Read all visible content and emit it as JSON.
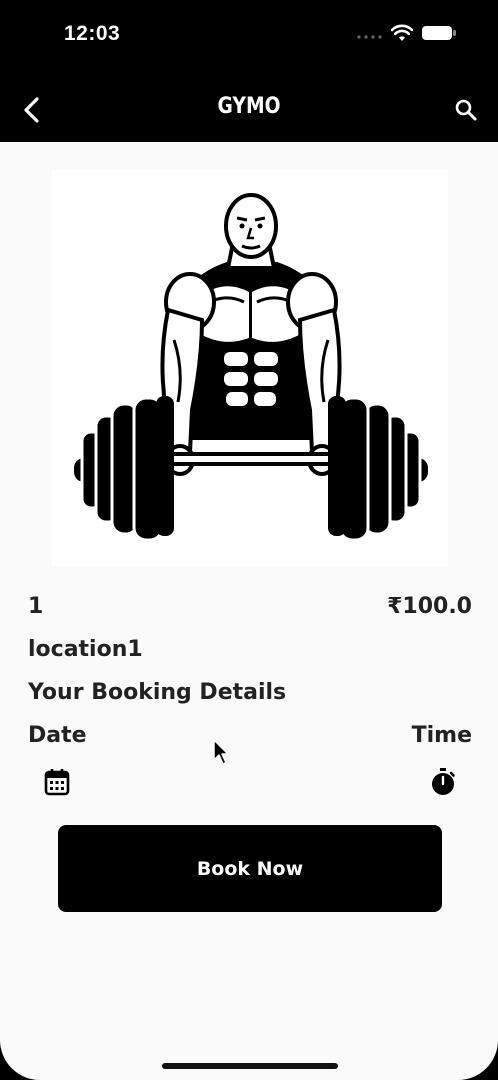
{
  "status_bar": {
    "time": "12:03",
    "signal_icon": "cellular-signal-icon",
    "wifi_icon": "wifi-icon",
    "battery_icon": "battery-icon"
  },
  "app_bar": {
    "title": "GYMO",
    "back_icon": "chevron-left-icon",
    "search_icon": "search-icon"
  },
  "gym": {
    "image": "bodybuilder-barbell-illustration",
    "id": "1",
    "price": "₹100.0",
    "location": "location1"
  },
  "booking": {
    "heading": "Your Booking Details",
    "date_label": "Date",
    "time_label": "Time",
    "calendar_icon": "calendar-icon",
    "timer_icon": "stopwatch-icon",
    "book_button_label": "Book Now"
  },
  "colors": {
    "primary": "#000000",
    "background": "#fafafa",
    "text": "#222222",
    "on_primary": "#ffffff"
  }
}
